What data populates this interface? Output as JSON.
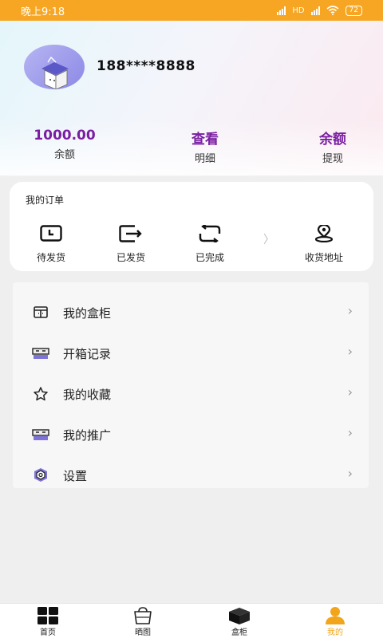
{
  "status_bar": {
    "time": "晚上9:18",
    "network": "HD",
    "battery": "72"
  },
  "profile": {
    "phone": "188****8888"
  },
  "stats": [
    {
      "value": "1000.00",
      "label": "余额"
    },
    {
      "value": "查看",
      "label": "明细"
    },
    {
      "value": "余额",
      "label": "提现"
    }
  ],
  "orders": {
    "title": "我的订单",
    "items": [
      {
        "label": "待发货",
        "icon": "pending-shipment-icon"
      },
      {
        "label": "已发货",
        "icon": "shipped-icon"
      },
      {
        "label": "已完成",
        "icon": "completed-icon"
      },
      {
        "label": "收货地址",
        "icon": "address-pin-icon"
      }
    ]
  },
  "menu": {
    "items": [
      {
        "label": "我的盒柜",
        "icon": "cabinet-icon"
      },
      {
        "label": "开箱记录",
        "icon": "ticket-icon"
      },
      {
        "label": "我的收藏",
        "icon": "star-icon"
      },
      {
        "label": "我的推广",
        "icon": "ticket-icon"
      },
      {
        "label": "设置",
        "icon": "settings-hexagon-icon"
      }
    ],
    "chevron": "›"
  },
  "bottom_nav": {
    "items": [
      {
        "label": "首页",
        "icon": "home-grid-icon"
      },
      {
        "label": "晒图",
        "icon": "bag-icon"
      },
      {
        "label": "盒柜",
        "icon": "box-icon"
      },
      {
        "label": "我的",
        "icon": "user-icon"
      }
    ],
    "active_color": "#f2a51a"
  },
  "colors": {
    "accent": "#7a1fa2",
    "status_bar": "#f6a623"
  }
}
